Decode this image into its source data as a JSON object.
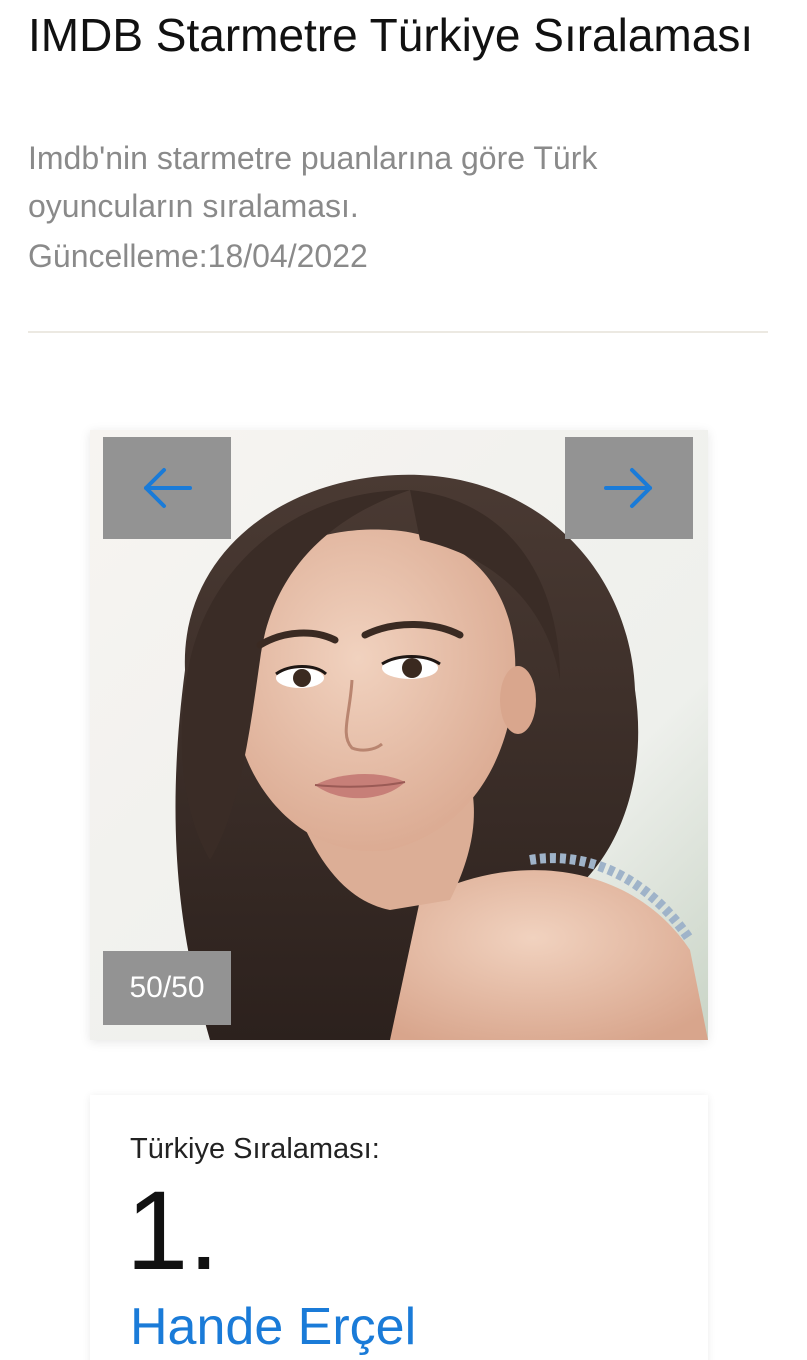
{
  "header": {
    "title": "IMDB Starmetre Türkiye Sıralaması",
    "subtitle": "Imdb'nin starmetre puanlarına göre Türk oyuncuların sıralaması.",
    "updated": "Güncelleme:18/04/2022"
  },
  "slider": {
    "counter": "50/50",
    "prev_icon": "arrow-left-icon",
    "next_icon": "arrow-right-icon",
    "accent_color": "#1a7bd8",
    "button_bg": "#939393"
  },
  "rank": {
    "label": "Türkiye Sıralaması:",
    "number": "1.",
    "name": "Hande Erçel"
  }
}
